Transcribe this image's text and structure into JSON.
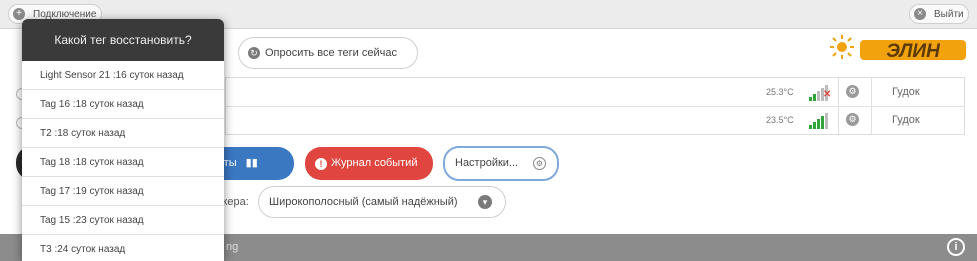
{
  "topbar": {
    "connect_label": "Подключение",
    "logout_label": "Выйти"
  },
  "main": {
    "poll_all_label": "Опросить все теги сейчас",
    "logo_text": "ЭЛИН"
  },
  "tags": [
    {
      "temperature": "25.3°C",
      "signal": 2,
      "signal_color": "#e04b3f",
      "action": "Гудок"
    },
    {
      "temperature": "23.5°C",
      "signal": 4,
      "signal_color": "#2fa537",
      "action": "Гудок"
    }
  ],
  "buttons": {
    "results_label": "ьтаты",
    "log_label": "Журнал событий",
    "settings_label": "Настройки..."
  },
  "mode": {
    "label": "жера:",
    "value": "Широкополосный (самый надёжный)"
  },
  "footer": {
    "text": "ng"
  },
  "popup": {
    "title": "Какой тег восстановить?",
    "items": [
      "Light Sensor 21 :16 суток назад",
      "Tag 16 :18 суток назад",
      "T2 :18 суток назад",
      "Tag 18 :18 суток назад",
      "Tag 17 :19 суток назад",
      "Tag 15 :23 суток назад",
      "T3 :24 суток назад"
    ]
  },
  "colors": {
    "accent_blue": "#3a78c2",
    "accent_red": "#e0463f",
    "signal_green": "#2fa537",
    "signal_red": "#e04b3f"
  }
}
